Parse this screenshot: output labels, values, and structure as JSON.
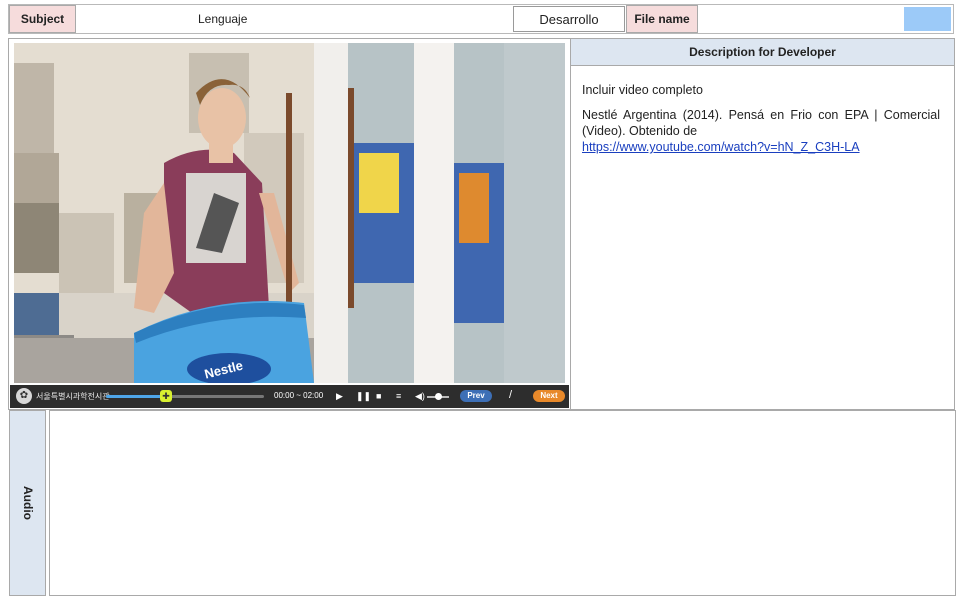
{
  "header": {
    "subject_label": "Subject",
    "subject_value": "Lenguaje",
    "stage_value": "Desarrollo",
    "file_name_label": "File name",
    "file_name_value": ""
  },
  "player": {
    "logo_icon": "seal-logo-icon",
    "org_name": "서울특별시과학전시관",
    "time_display": "00:00 ~ 02:00",
    "progress_fraction": 0.38,
    "volume_fraction": 0.5,
    "controls": {
      "play_icon": "play-icon",
      "pause_icon": "pause-icon",
      "stop_icon": "stop-icon",
      "list_icon": "list-icon",
      "volume_icon": "volume-icon"
    },
    "prev_label": "Prev",
    "separator": "/",
    "next_label": "Next",
    "colors": {
      "prev": "#3d6fb6",
      "next": "#e8892a",
      "progress": "#4ea5e8",
      "thumb": "#d8f030"
    }
  },
  "description": {
    "title": "Description for Developer",
    "line1": "Incluir video completo",
    "citation": "Nestlé Argentina (2014). Pensá en Frio con EPA | Comercial (Video). Obtenido de",
    "link": "https://www.youtube.com/watch?v=hN_Z_C3H-LA"
  },
  "video": {
    "freezer_brand": "Nestle"
  },
  "audio": {
    "label": "Audio"
  },
  "colors": {
    "label_bg": "#f6dcdc",
    "panel_header_bg": "#dde6f1",
    "accent_button": "#9ccaf8"
  }
}
